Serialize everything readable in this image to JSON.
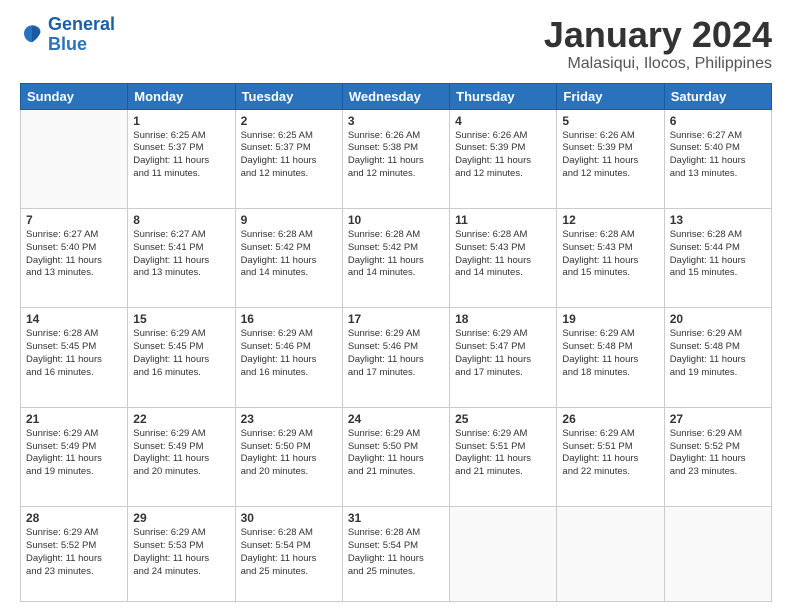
{
  "logo": {
    "line1": "General",
    "line2": "Blue"
  },
  "title": "January 2024",
  "subtitle": "Malasiqui, Ilocos, Philippines",
  "calendar": {
    "headers": [
      "Sunday",
      "Monday",
      "Tuesday",
      "Wednesday",
      "Thursday",
      "Friday",
      "Saturday"
    ],
    "weeks": [
      [
        {
          "day": "",
          "info": ""
        },
        {
          "day": "1",
          "info": "Sunrise: 6:25 AM\nSunset: 5:37 PM\nDaylight: 11 hours\nand 11 minutes."
        },
        {
          "day": "2",
          "info": "Sunrise: 6:25 AM\nSunset: 5:37 PM\nDaylight: 11 hours\nand 12 minutes."
        },
        {
          "day": "3",
          "info": "Sunrise: 6:26 AM\nSunset: 5:38 PM\nDaylight: 11 hours\nand 12 minutes."
        },
        {
          "day": "4",
          "info": "Sunrise: 6:26 AM\nSunset: 5:39 PM\nDaylight: 11 hours\nand 12 minutes."
        },
        {
          "day": "5",
          "info": "Sunrise: 6:26 AM\nSunset: 5:39 PM\nDaylight: 11 hours\nand 12 minutes."
        },
        {
          "day": "6",
          "info": "Sunrise: 6:27 AM\nSunset: 5:40 PM\nDaylight: 11 hours\nand 13 minutes."
        }
      ],
      [
        {
          "day": "7",
          "info": "Sunrise: 6:27 AM\nSunset: 5:40 PM\nDaylight: 11 hours\nand 13 minutes."
        },
        {
          "day": "8",
          "info": "Sunrise: 6:27 AM\nSunset: 5:41 PM\nDaylight: 11 hours\nand 13 minutes."
        },
        {
          "day": "9",
          "info": "Sunrise: 6:28 AM\nSunset: 5:42 PM\nDaylight: 11 hours\nand 14 minutes."
        },
        {
          "day": "10",
          "info": "Sunrise: 6:28 AM\nSunset: 5:42 PM\nDaylight: 11 hours\nand 14 minutes."
        },
        {
          "day": "11",
          "info": "Sunrise: 6:28 AM\nSunset: 5:43 PM\nDaylight: 11 hours\nand 14 minutes."
        },
        {
          "day": "12",
          "info": "Sunrise: 6:28 AM\nSunset: 5:43 PM\nDaylight: 11 hours\nand 15 minutes."
        },
        {
          "day": "13",
          "info": "Sunrise: 6:28 AM\nSunset: 5:44 PM\nDaylight: 11 hours\nand 15 minutes."
        }
      ],
      [
        {
          "day": "14",
          "info": "Sunrise: 6:28 AM\nSunset: 5:45 PM\nDaylight: 11 hours\nand 16 minutes."
        },
        {
          "day": "15",
          "info": "Sunrise: 6:29 AM\nSunset: 5:45 PM\nDaylight: 11 hours\nand 16 minutes."
        },
        {
          "day": "16",
          "info": "Sunrise: 6:29 AM\nSunset: 5:46 PM\nDaylight: 11 hours\nand 16 minutes."
        },
        {
          "day": "17",
          "info": "Sunrise: 6:29 AM\nSunset: 5:46 PM\nDaylight: 11 hours\nand 17 minutes."
        },
        {
          "day": "18",
          "info": "Sunrise: 6:29 AM\nSunset: 5:47 PM\nDaylight: 11 hours\nand 17 minutes."
        },
        {
          "day": "19",
          "info": "Sunrise: 6:29 AM\nSunset: 5:48 PM\nDaylight: 11 hours\nand 18 minutes."
        },
        {
          "day": "20",
          "info": "Sunrise: 6:29 AM\nSunset: 5:48 PM\nDaylight: 11 hours\nand 19 minutes."
        }
      ],
      [
        {
          "day": "21",
          "info": "Sunrise: 6:29 AM\nSunset: 5:49 PM\nDaylight: 11 hours\nand 19 minutes."
        },
        {
          "day": "22",
          "info": "Sunrise: 6:29 AM\nSunset: 5:49 PM\nDaylight: 11 hours\nand 20 minutes."
        },
        {
          "day": "23",
          "info": "Sunrise: 6:29 AM\nSunset: 5:50 PM\nDaylight: 11 hours\nand 20 minutes."
        },
        {
          "day": "24",
          "info": "Sunrise: 6:29 AM\nSunset: 5:50 PM\nDaylight: 11 hours\nand 21 minutes."
        },
        {
          "day": "25",
          "info": "Sunrise: 6:29 AM\nSunset: 5:51 PM\nDaylight: 11 hours\nand 21 minutes."
        },
        {
          "day": "26",
          "info": "Sunrise: 6:29 AM\nSunset: 5:51 PM\nDaylight: 11 hours\nand 22 minutes."
        },
        {
          "day": "27",
          "info": "Sunrise: 6:29 AM\nSunset: 5:52 PM\nDaylight: 11 hours\nand 23 minutes."
        }
      ],
      [
        {
          "day": "28",
          "info": "Sunrise: 6:29 AM\nSunset: 5:52 PM\nDaylight: 11 hours\nand 23 minutes."
        },
        {
          "day": "29",
          "info": "Sunrise: 6:29 AM\nSunset: 5:53 PM\nDaylight: 11 hours\nand 24 minutes."
        },
        {
          "day": "30",
          "info": "Sunrise: 6:28 AM\nSunset: 5:54 PM\nDaylight: 11 hours\nand 25 minutes."
        },
        {
          "day": "31",
          "info": "Sunrise: 6:28 AM\nSunset: 5:54 PM\nDaylight: 11 hours\nand 25 minutes."
        },
        {
          "day": "",
          "info": ""
        },
        {
          "day": "",
          "info": ""
        },
        {
          "day": "",
          "info": ""
        }
      ]
    ]
  }
}
